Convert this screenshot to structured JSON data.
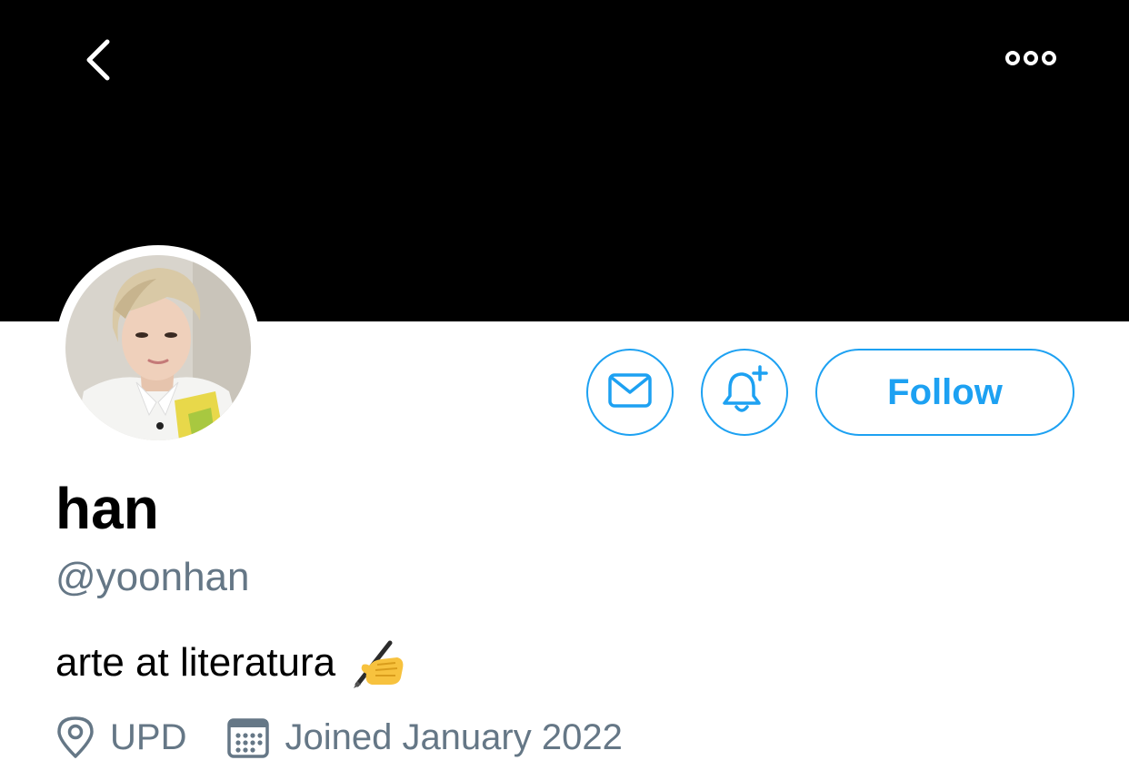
{
  "header": {
    "back_icon": "chevron-left-icon",
    "more_icon": "more-horizontal-icon"
  },
  "profile": {
    "display_name": "han",
    "handle": "@yoonhan",
    "bio": "arte at literatura",
    "bio_emoji": "writing-hand-emoji",
    "location": "UPD",
    "location_icon": "location-pin-icon",
    "joined": "Joined January 2022",
    "joined_icon": "calendar-icon"
  },
  "actions": {
    "message_icon": "envelope-icon",
    "notify_icon": "bell-plus-icon",
    "follow_label": "Follow"
  },
  "colors": {
    "accent": "#1da1f2",
    "secondary_text": "#657786",
    "banner": "#000000"
  }
}
